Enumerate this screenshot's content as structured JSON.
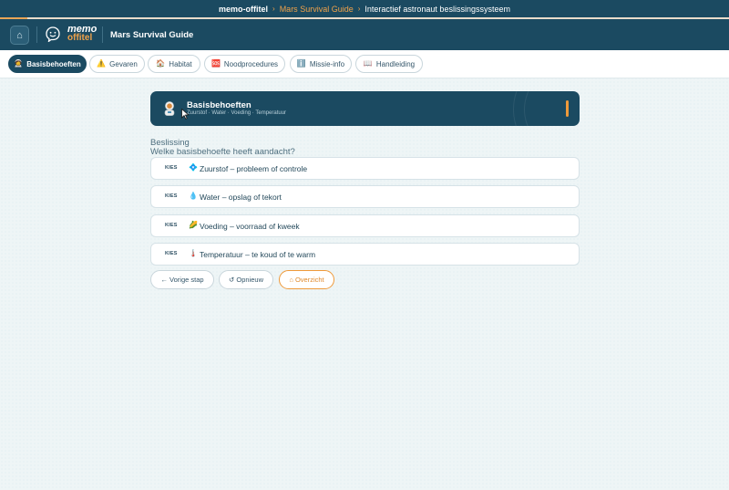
{
  "topbar": {
    "brand": "memo-offitel",
    "separator": "›",
    "guide": "Mars Survival Guide",
    "separator2": "›",
    "subtitle": "Interactief astronaut beslissingssysteem"
  },
  "header": {
    "home_icon": "⌂",
    "logo_line1": "memo",
    "logo_line2": "offitel",
    "title": "Mars Survival Guide"
  },
  "nav": {
    "tabs": [
      {
        "icon": "🧑‍🚀",
        "label": "Basisbehoeften",
        "active": true
      },
      {
        "icon": "⚠️",
        "label": "Gevaren",
        "active": false
      },
      {
        "icon": "🏠",
        "label": "Habitat",
        "active": false
      },
      {
        "icon": "🆘",
        "label": "Noodprocedures",
        "active": false
      },
      {
        "icon": "ℹ️",
        "label": "Missie-info",
        "active": false
      },
      {
        "icon": "📖",
        "label": "Handleiding",
        "active": false
      }
    ]
  },
  "card": {
    "title": "Basisbehoeften",
    "subtitle": "Zuurstof · Water · Voeding · Temperatuur"
  },
  "question": {
    "label": "Beslissing",
    "text": "Welke basisbehoefte heeft aandacht?"
  },
  "options": [
    {
      "kies": "KIES",
      "icon": "💠",
      "label": "Zuurstof – probleem of controle"
    },
    {
      "kies": "KIES",
      "icon": "💧",
      "label": "Water – opslag of tekort"
    },
    {
      "kies": "KIES",
      "icon": "🌽",
      "label": "Voeding – voorraad of kweek"
    },
    {
      "kies": "KIES",
      "icon": "🌡️",
      "label": "Temperatuur – te koud of te warm"
    }
  ],
  "buttons": {
    "back": "← Vorige stap",
    "restart": "↺ Opnieuw",
    "overview": "⌂ Overzicht"
  },
  "colors": {
    "primary": "#1b4a61",
    "accent": "#ef9a3a",
    "background": "#eef5f6"
  },
  "icons": {
    "home": "home-icon",
    "logo": "chat-smile-icon",
    "astronaut": "astronaut-icon",
    "cursor": "mouse-pointer-icon"
  }
}
